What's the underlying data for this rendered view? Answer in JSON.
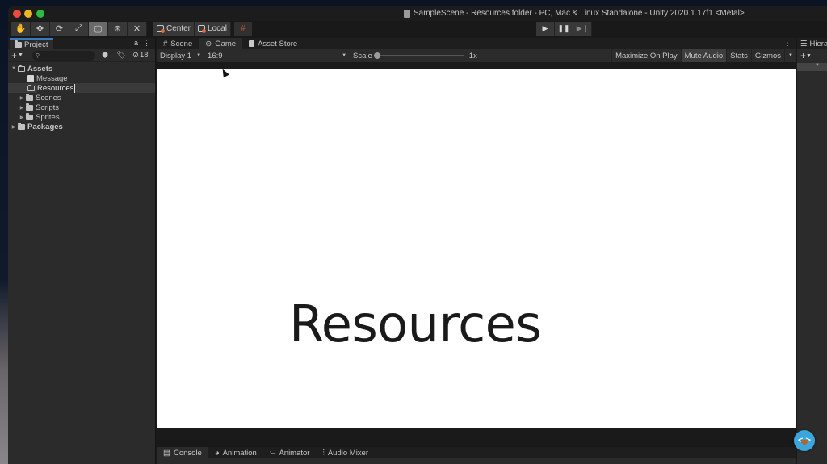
{
  "window": {
    "title": "SampleScene - Resources folder - PC, Mac & Linux Standalone - Unity 2020.1.17f1 <Metal>"
  },
  "toolbar": {
    "tools": [
      {
        "name": "hand-tool",
        "glyph": "✋"
      },
      {
        "name": "move-tool",
        "glyph": "✥"
      },
      {
        "name": "rotate-tool",
        "glyph": "⟳"
      },
      {
        "name": "scale-tool",
        "glyph": "⤢"
      },
      {
        "name": "rect-tool",
        "glyph": "▢"
      },
      {
        "name": "transform-tool",
        "glyph": "⊛"
      },
      {
        "name": "custom-tool",
        "glyph": "✕"
      }
    ],
    "active_tool": "rect-tool",
    "pivot_label": "Center",
    "rotation_label": "Local",
    "play_glyph": "▶",
    "pause_glyph": "❚❚",
    "step_glyph": "▶❘"
  },
  "project": {
    "tab_label": "Project",
    "lock_glyph": "a",
    "menu_glyph": "⋮",
    "add_glyph": "+",
    "search_placeholder": "",
    "search_icon_glyph": "⚲",
    "hidden_count": "18",
    "tree": [
      {
        "label": "Assets",
        "level": 0,
        "expanded": true,
        "type": "folder-open",
        "bold": true
      },
      {
        "label": "Message",
        "level": 1,
        "type": "file"
      },
      {
        "label": "Resources",
        "level": 1,
        "type": "folder-empty",
        "selected": true,
        "editing": true
      },
      {
        "label": "Scenes",
        "level": 1,
        "collapsed": true,
        "type": "folder"
      },
      {
        "label": "Scripts",
        "level": 1,
        "collapsed": true,
        "type": "folder"
      },
      {
        "label": "Sprites",
        "level": 1,
        "collapsed": true,
        "type": "folder"
      },
      {
        "label": "Packages",
        "level": 0,
        "collapsed": true,
        "type": "folder",
        "bold": true
      }
    ]
  },
  "game": {
    "tabs": [
      {
        "label": "Scene",
        "glyph": "#"
      },
      {
        "label": "Game",
        "glyph": "⊝",
        "active": true
      },
      {
        "label": "Asset Store",
        "glyph": "🛍"
      }
    ],
    "display": "Display 1",
    "aspect": "16:9",
    "scale_label": "Scale",
    "scale_value": "1x",
    "maximize_on_play": "Maximize On Play",
    "mute_audio": "Mute Audio",
    "stats": "Stats",
    "gizmos": "Gizmos",
    "canvas_text": "Resources"
  },
  "hierarchy": {
    "tab_label": "Hierarchy",
    "add_glyph": "+"
  },
  "console": {
    "tabs": [
      {
        "label": "Console",
        "glyph": "▤",
        "active": true
      },
      {
        "label": "Animation",
        "glyph": "◕"
      },
      {
        "label": "Animator",
        "glyph": "⤚"
      },
      {
        "label": "Audio Mixer",
        "glyph": "⫶"
      }
    ]
  },
  "colors": {
    "accent": "#3a79bb",
    "bubble": "#3ca6dc"
  }
}
